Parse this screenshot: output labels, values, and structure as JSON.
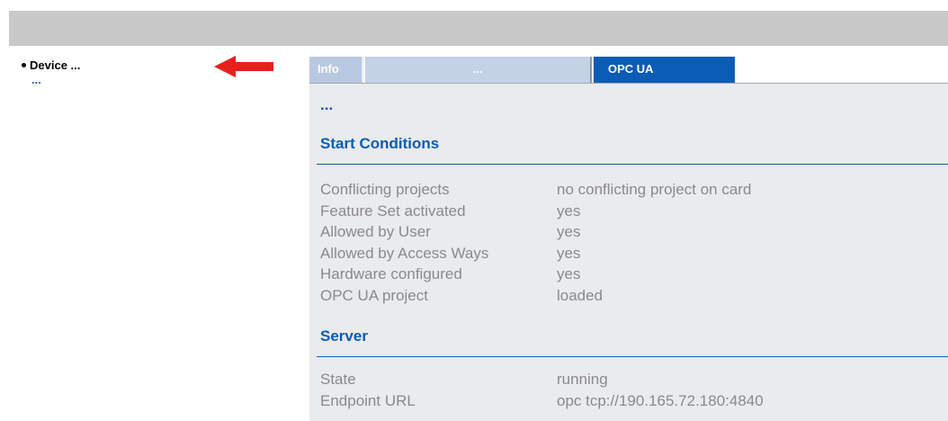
{
  "nav": {
    "device_label": "Device ...",
    "sub_label": "..."
  },
  "arrow": {
    "color": "#e8201c",
    "icon": "left-arrow-icon"
  },
  "tabs": [
    {
      "label": "Info",
      "active": false
    },
    {
      "label": "...",
      "active": false
    },
    {
      "label": "OPC UA",
      "active": true
    }
  ],
  "content": {
    "intro": "...",
    "start_conditions": {
      "title": "Start Conditions",
      "rows": [
        {
          "label": "Conflicting projects",
          "value": "no conflicting project on card"
        },
        {
          "label": "Feature Set activated",
          "value": "yes"
        },
        {
          "label": "Allowed by User",
          "value": "yes"
        },
        {
          "label": "Allowed by Access Ways",
          "value": "yes"
        },
        {
          "label": "Hardware configured",
          "value": "yes"
        },
        {
          "label": "OPC UA project",
          "value": "loaded"
        }
      ]
    },
    "server": {
      "title": "Server",
      "rows": [
        {
          "label": "State",
          "value": "running"
        },
        {
          "label": "Endpoint URL",
          "value": "opc tcp://190.165.72.180:4840"
        }
      ]
    }
  },
  "colors": {
    "accent": "#0b5cb5",
    "top_bar": "#c8c8c8",
    "panel_bg": "#e9ebee",
    "muted_text": "#8a8a8a"
  }
}
